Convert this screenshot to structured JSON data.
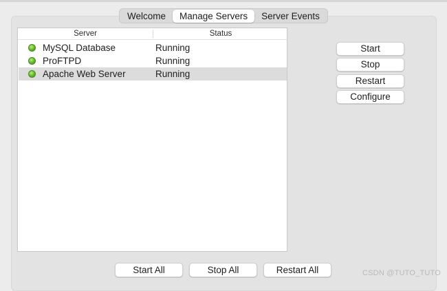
{
  "tabs": [
    {
      "label": "Welcome",
      "selected": false
    },
    {
      "label": "Manage Servers",
      "selected": true
    },
    {
      "label": "Server Events",
      "selected": false
    }
  ],
  "table": {
    "columns": [
      "Server",
      "Status"
    ],
    "rows": [
      {
        "name": "MySQL Database",
        "status": "Running",
        "status_icon": "green-status-icon",
        "selected": false
      },
      {
        "name": "ProFTPD",
        "status": "Running",
        "status_icon": "green-status-icon",
        "selected": false
      },
      {
        "name": "Apache Web Server",
        "status": "Running",
        "status_icon": "green-status-icon",
        "selected": true
      }
    ]
  },
  "actions": {
    "start": "Start",
    "stop": "Stop",
    "restart": "Restart",
    "configure": "Configure"
  },
  "bulk_actions": {
    "start_all": "Start All",
    "stop_all": "Stop All",
    "restart_all": "Restart All"
  },
  "watermark": "CSDN @TUTO_TUTO",
  "colors": {
    "window_bg": "#ececec",
    "selected_row": "#dcdcdc",
    "status_green": "#5fb52a"
  }
}
